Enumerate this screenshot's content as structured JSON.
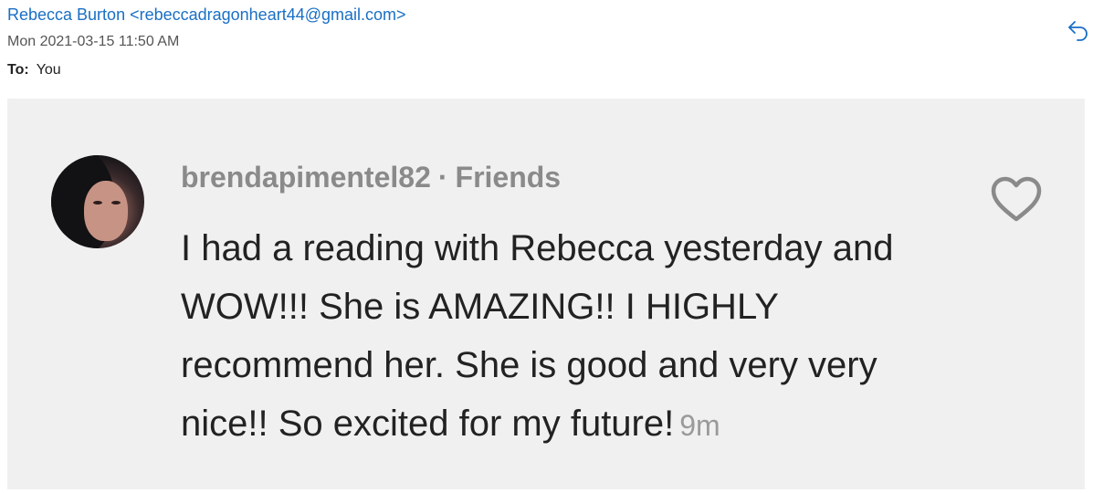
{
  "email": {
    "sender": "Rebecca Burton <rebeccadragonheart44@gmail.com>",
    "date": "Mon 2021-03-15 11:50 AM",
    "to_label": "To:",
    "to_value": "You",
    "reply_icon": "reply-icon"
  },
  "comment": {
    "username": "brendapimentel82",
    "separator": "·",
    "relation": "Friends",
    "text": "I had a reading with Rebecca yesterday and WOW!!! She is AMAZING!! I HIGHLY recommend her. She is good and very very nice!! So excited for my future!",
    "time": "9m",
    "like_icon": "heart-icon",
    "avatar": "avatar"
  },
  "colors": {
    "sender": "#1a6fc4",
    "card_background": "#f0f0f0",
    "username": "#8a8a8a"
  }
}
